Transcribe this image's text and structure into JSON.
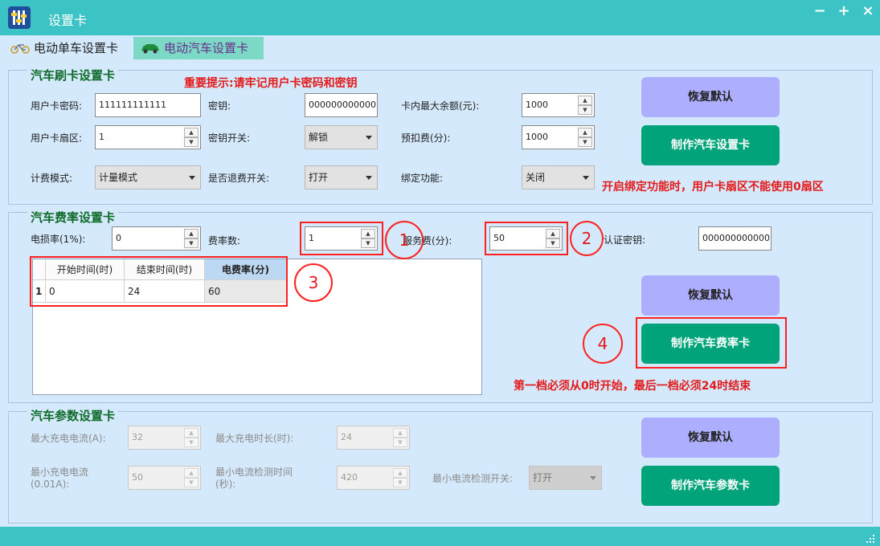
{
  "window": {
    "title": "设置卡",
    "minimize": "−",
    "maximize": "+",
    "close": "×"
  },
  "tabs": [
    {
      "label": "电动单车设置卡",
      "icon": "bicycle-icon",
      "active": false
    },
    {
      "label": "电动汽车设置卡",
      "icon": "car-icon",
      "active": true
    }
  ],
  "card_settings": {
    "title": "汽车刷卡设置卡",
    "notice": "重要提示:请牢记用户卡密码和密钥",
    "user_password": {
      "label": "用户卡密码:",
      "value": "111111111111"
    },
    "key": {
      "label": "密钥:",
      "value": "000000000000"
    },
    "max_balance": {
      "label": "卡内最大余额(元):",
      "value": "1000"
    },
    "user_sector": {
      "label": "用户卡扇区:",
      "value": "1"
    },
    "key_switch": {
      "label": "密钥开关:",
      "value": "解锁"
    },
    "prepay": {
      "label": "预扣费(分):",
      "value": "1000"
    },
    "billing_mode": {
      "label": "计费模式:",
      "value": "计量模式"
    },
    "refund_switch": {
      "label": "是否退费开关:",
      "value": "打开"
    },
    "bind_function": {
      "label": "绑定功能:",
      "value": "关闭"
    },
    "bind_warning": "开启绑定功能时，用户卡扇区不能使用0扇区",
    "restore_button": "恢复默认",
    "make_button": "制作汽车设置卡"
  },
  "rate_settings": {
    "title": "汽车费率设置卡",
    "loss_rate": {
      "label": "电损率(1%):",
      "value": "0"
    },
    "rate_count": {
      "label": "费率数:",
      "value": "1"
    },
    "service_fee": {
      "label": "服务费(分):",
      "value": "50"
    },
    "auth_key": {
      "label": "认证密钥:",
      "value": "000000000000"
    },
    "table": {
      "columns": [
        "开始时间(时)",
        "结束时间(时)",
        "电费率(分)"
      ],
      "rows": [
        {
          "index": "1",
          "start": "0",
          "end": "24",
          "rate": "60"
        }
      ]
    },
    "restore_button": "恢复默认",
    "make_button": "制作汽车费率卡",
    "warning": "第一档必须从0时开始，最后一档必须24时结束"
  },
  "annotations": [
    "1",
    "2",
    "3",
    "4"
  ],
  "param_settings": {
    "title": "汽车参数设置卡",
    "max_current": {
      "label": "最大充电电流(A):",
      "value": "32"
    },
    "max_duration": {
      "label": "最大充电时长(时):",
      "value": "24"
    },
    "min_current": {
      "label": "最小充电电流",
      "label2": "(0.01A):",
      "value": "50"
    },
    "min_detect_time": {
      "label": "最小电流检测时间",
      "label2": "(秒):",
      "value": "420"
    },
    "min_detect_switch": {
      "label": "最小电流检测开关:",
      "value": "打开"
    },
    "restore_button": "恢复默认",
    "make_button": "制作汽车参数卡"
  },
  "colors": {
    "titlebar": "#3cc3c5",
    "background": "#d4e9fb",
    "group_title": "#0f6b2a",
    "warning": "#e41a1a",
    "button_violet": "#aeaeff",
    "button_green": "#00a37a"
  }
}
